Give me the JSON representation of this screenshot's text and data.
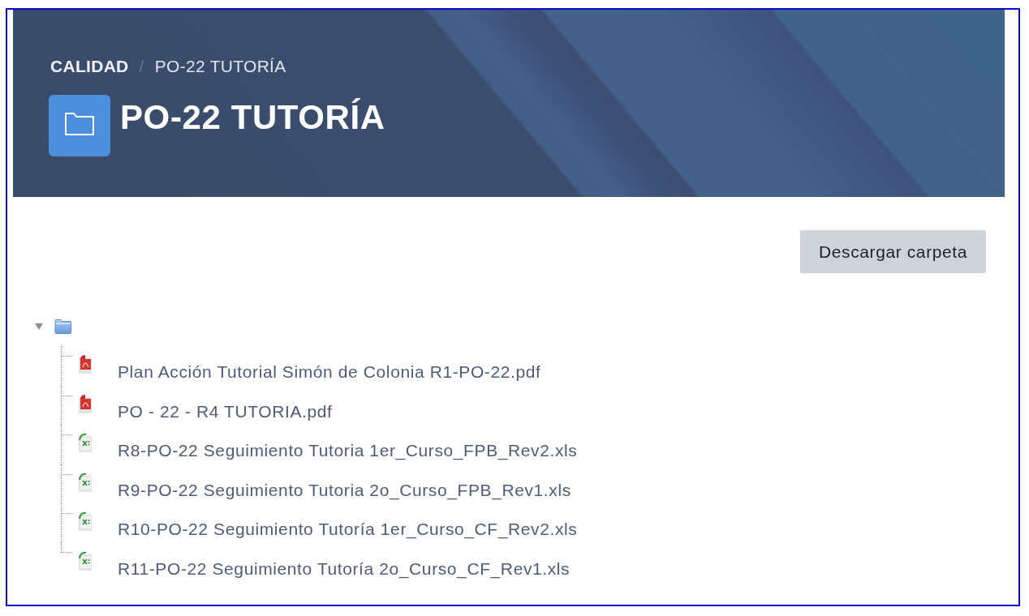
{
  "header": {
    "breadcrumb": {
      "items": [
        "CALIDAD",
        "PO-22 TUTORÍA"
      ],
      "separator": "/"
    },
    "title": "PO-22 TUTORÍA"
  },
  "actions": {
    "download_button": "Descargar carpeta"
  },
  "folder_tree": {
    "expanded": true,
    "children": [
      {
        "name": "Plan Acción Tutorial Simón de Colonia R1-PO-22.pdf",
        "kind": "pdf"
      },
      {
        "name": "PO - 22 - R4 TUTORIA.pdf",
        "kind": "pdf"
      },
      {
        "name": "R8-PO-22 Seguimiento Tutoria 1er_Curso_FPB_Rev2.xls",
        "kind": "xls"
      },
      {
        "name": "R9-PO-22 Seguimiento Tutoria 2o_Curso_FPB_Rev1.xls",
        "kind": "xls"
      },
      {
        "name": "R10-PO-22 Seguimiento Tutoría 1er_Curso_CF_Rev2.xls",
        "kind": "xls"
      },
      {
        "name": "R11-PO-22 Seguimiento Tutoría 2o_Curso_CF_Rev1.xls",
        "kind": "xls"
      }
    ]
  }
}
